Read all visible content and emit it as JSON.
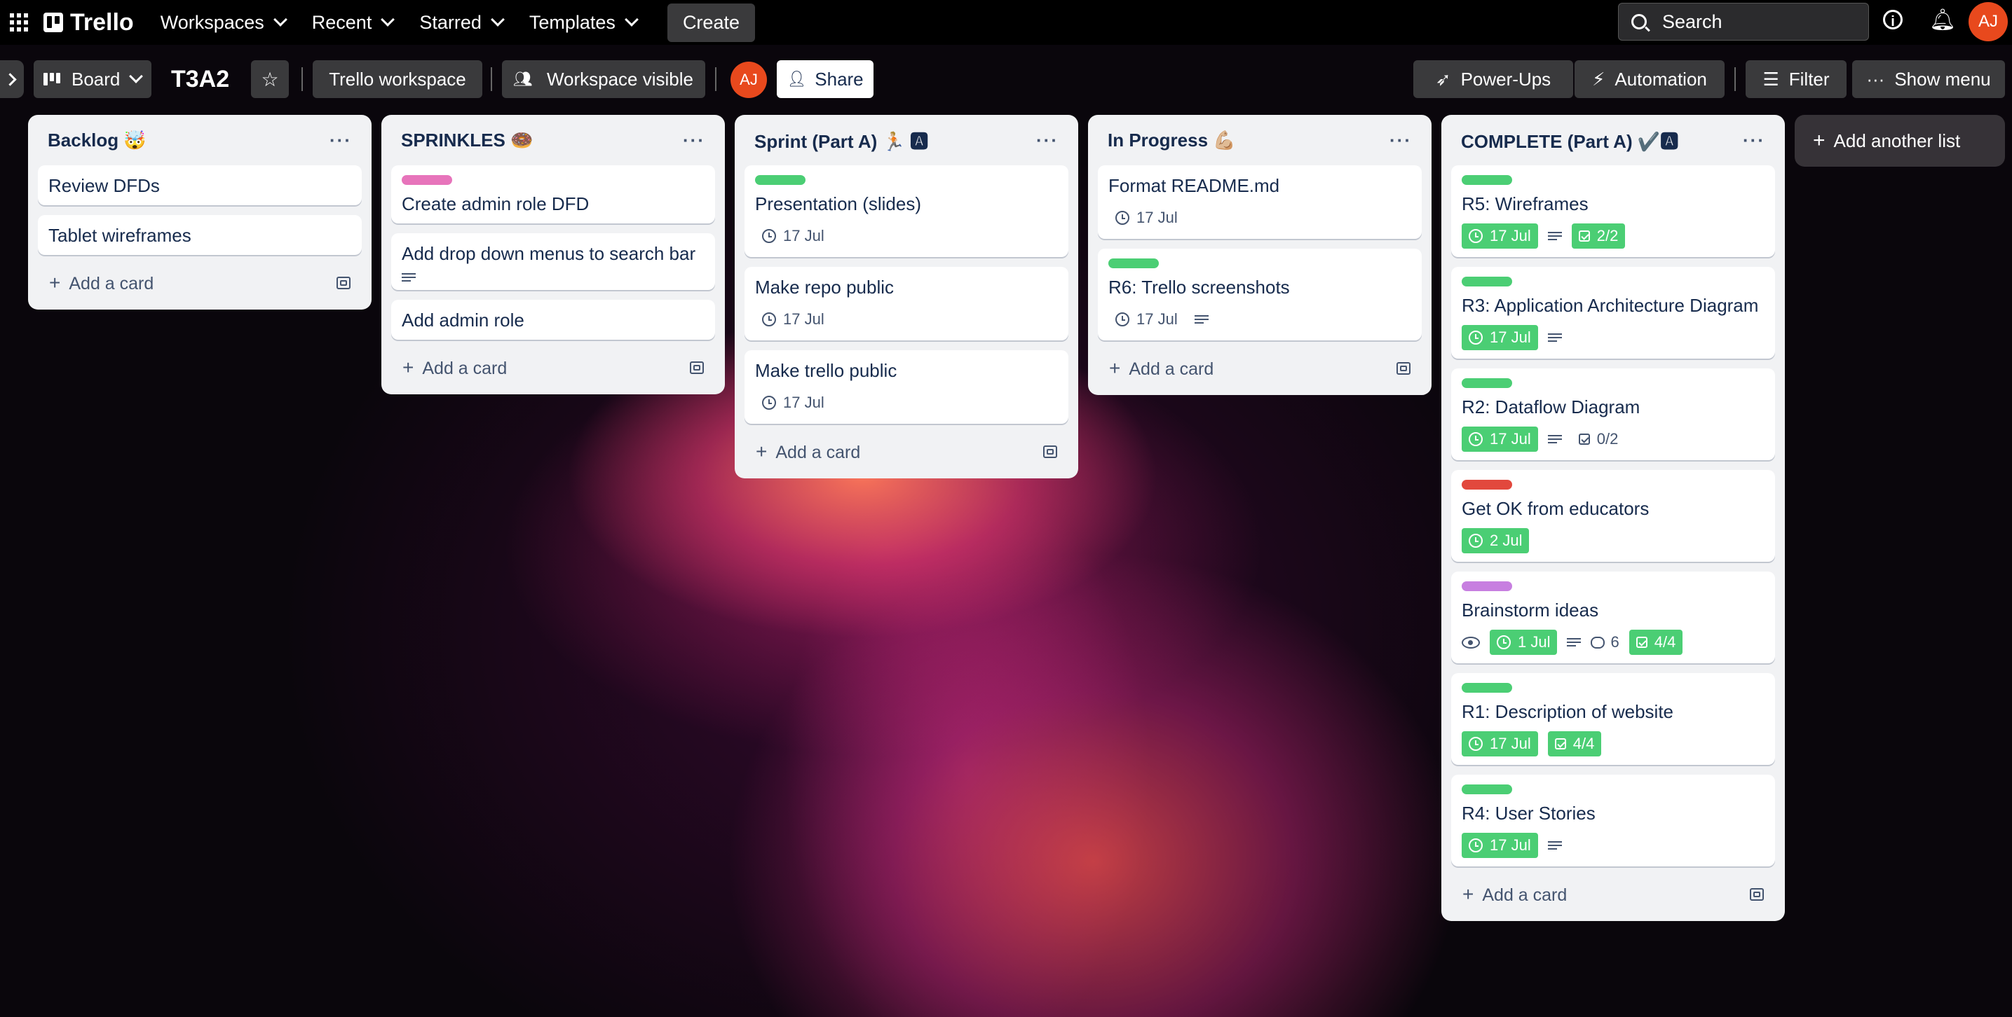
{
  "topbar": {
    "app_name": "Trello",
    "nav": [
      "Workspaces",
      "Recent",
      "Starred",
      "Templates"
    ],
    "create_label": "Create",
    "search_placeholder": "Search",
    "avatar_initials": "AJ"
  },
  "board": {
    "view_label": "Board",
    "title": "T3A2",
    "workspace_label": "Trello workspace",
    "visibility_label": "Workspace visible",
    "member_initials": "AJ",
    "share_label": "Share",
    "powerups_label": "Power-Ups",
    "automation_label": "Automation",
    "filter_label": "Filter",
    "show_menu_label": "Show menu",
    "add_list_label": "Add another list"
  },
  "lists": [
    {
      "title": "Backlog 🤯",
      "add_card_label": "Add a card",
      "cards": [
        {
          "title": "Review DFDs"
        },
        {
          "title": "Tablet wireframes"
        }
      ]
    },
    {
      "title": "SPRINKLES 🍩",
      "add_card_label": "Add a card",
      "cards": [
        {
          "title": "Create admin role DFD",
          "label_color": "#e774bb"
        },
        {
          "title": "Add drop down menus to search bar"
        },
        {
          "title": "Add admin role"
        }
      ]
    },
    {
      "title": "Sprint (Part A) 🏃🏼 🅰",
      "add_card_label": "Add a card",
      "cards": [
        {
          "title": "Presentation (slides)",
          "label_color": "#4bce74",
          "date": "17 Jul"
        },
        {
          "title": "Make repo public",
          "date": "17 Jul"
        },
        {
          "title": "Make trello public",
          "date": "17 Jul"
        }
      ]
    },
    {
      "title": "In Progress 💪🏼",
      "add_card_label": "Add a card",
      "cards": [
        {
          "title": "Format README.md",
          "date": "17 Jul"
        },
        {
          "title": "R6: Trello screenshots",
          "label_color": "#4bce74",
          "date": "17 Jul"
        }
      ]
    },
    {
      "title": "COMPLETE (Part A) ✔️🅰",
      "add_card_label": "Add a card",
      "cards": [
        {
          "title": "R5: Wireframes",
          "label_color": "#4bce74",
          "date": "17 Jul",
          "checklist": "2/2"
        },
        {
          "title": "R3: Application Architecture Diagram",
          "label_color": "#4bce74",
          "date": "17 Jul"
        },
        {
          "title": "R2: Dataflow Diagram",
          "label_color": "#4bce74",
          "date": "17 Jul",
          "checklist": "0/2"
        },
        {
          "title": "Get OK from educators",
          "label_color": "#e2483d",
          "date": "2 Jul"
        },
        {
          "title": "Brainstorm ideas",
          "label_color": "#c77fe0",
          "date": "1 Jul",
          "comments": "6",
          "checklist": "4/4"
        },
        {
          "title": "R1: Description of website",
          "label_color": "#4bce74",
          "date": "17 Jul",
          "checklist": "4/4"
        },
        {
          "title": "R4: User Stories",
          "label_color": "#4bce74",
          "date": "17 Jul"
        }
      ]
    }
  ]
}
